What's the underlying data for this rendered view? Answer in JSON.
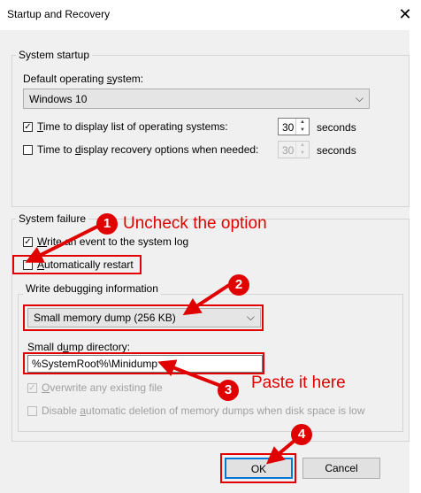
{
  "window": {
    "title": "Startup and Recovery",
    "close_glyph": "✕"
  },
  "system_startup": {
    "group_label": "System startup",
    "default_os_label": "Default operating system:",
    "default_os_value": "Windows 10",
    "time_list": {
      "label": "Time to display list of operating systems:",
      "checked": true,
      "value": "30",
      "unit": "seconds"
    },
    "time_recovery": {
      "label": "Time to display recovery options when needed:",
      "checked": false,
      "value": "30",
      "unit": "seconds"
    }
  },
  "system_failure": {
    "group_label": "System failure",
    "write_event_label": "Write an event to the system log",
    "auto_restart_label": "Automatically restart",
    "debug_group_label": "Write debugging information",
    "dump_type_value": "Small memory dump (256 KB)",
    "small_dump_dir_label": "Small dump directory:",
    "small_dump_dir_value": "%SystemRoot%\\Minidump",
    "overwrite_label": "Overwrite any existing file",
    "disable_auto_delete_label": "Disable automatic deletion of memory dumps when disk space is low"
  },
  "buttons": {
    "ok": "OK",
    "cancel": "Cancel"
  },
  "annotations": {
    "badge1": "1",
    "badge2": "2",
    "badge3": "3",
    "badge4": "4",
    "text1": "Uncheck the option",
    "text3": "Paste it here",
    "color": "#e00000"
  },
  "icons": {
    "check": "✓",
    "chevron": "chevron-down-icon"
  }
}
